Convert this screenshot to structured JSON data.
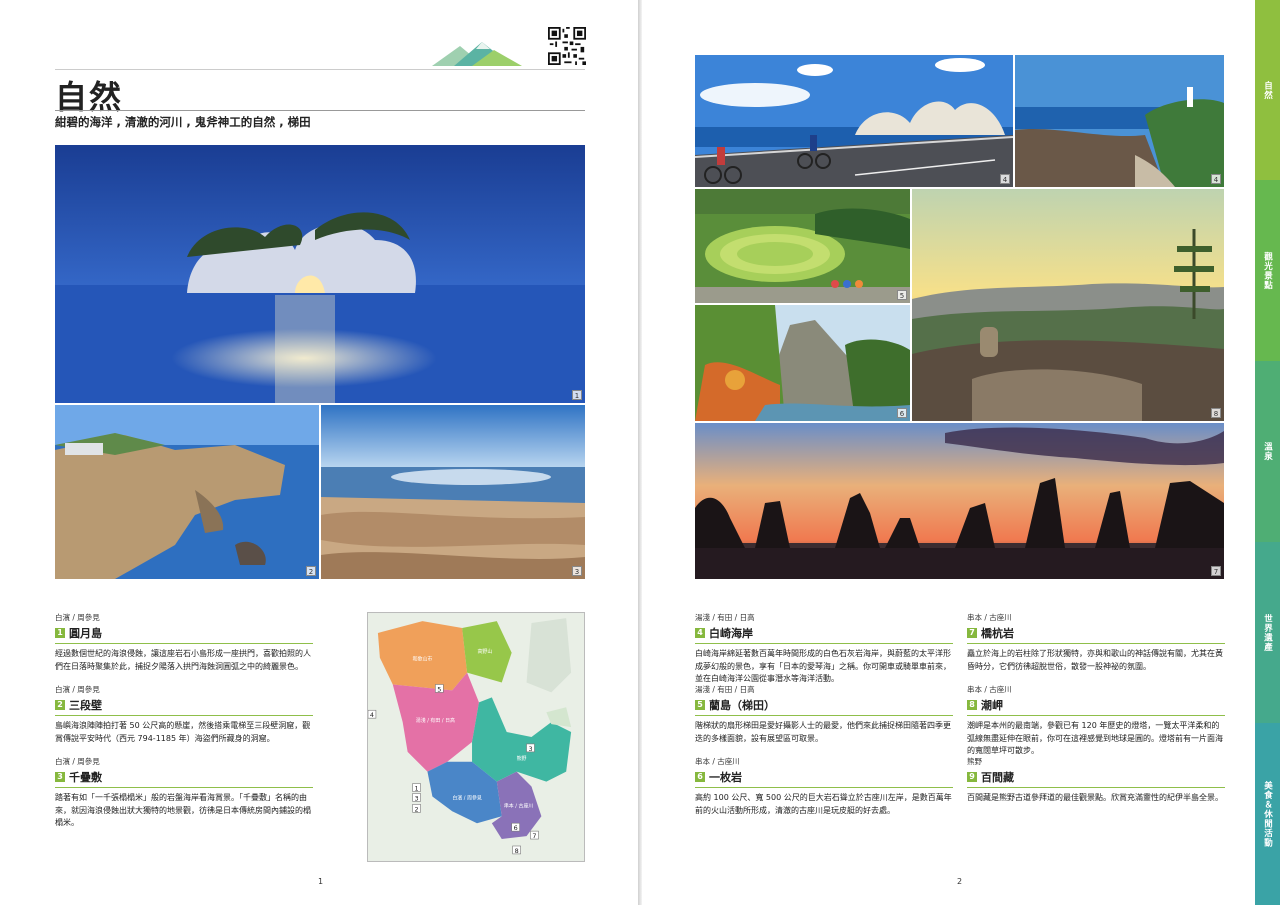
{
  "header": {
    "title": "自然",
    "subtitle": "紺碧的海洋 , 清澈的河川 , 鬼斧神工的自然 , 梯田"
  },
  "left_photos": [
    {
      "num": "1",
      "subject": "engetsu-island-moon"
    },
    {
      "num": "2",
      "subject": "sandanheki-cliffs"
    },
    {
      "num": "3",
      "subject": "senjojiki-rock-shelf"
    }
  ],
  "right_photos": [
    {
      "num": "4",
      "subject": "shirasaki-coast-cycling"
    },
    {
      "num": "4",
      "subject": "shirasaki-lighthouse"
    },
    {
      "num": "5",
      "subject": "aragijima-rice-terraces"
    },
    {
      "num": "6",
      "subject": "ichimaiiwa-autumn-gorge"
    },
    {
      "num": "8",
      "subject": "shionomisaki-sunset"
    },
    {
      "num": "7",
      "subject": "hashikuiiwa-silhouette"
    }
  ],
  "entries": [
    {
      "loc": "白濱 / 周參見",
      "num": "1",
      "name": "圓月島",
      "desc": "經過數個世紀的海浪侵蝕，讓這座岩石小島形成一座拱門，喜歡拍照的人們在日落時聚集於此，捕捉夕陽落入拱門海蝕洞圓弧之中的綺麗景色。"
    },
    {
      "loc": "白濱 / 周參見",
      "num": "2",
      "name": "三段壁",
      "desc": "島嶼海浪陣陣拍打著 50 公尺高的懸崖，然後搭乘電梯至三段壁洞窟，觀賞傳說平安時代（西元 794-1185 年）海盜們所藏身的洞窟。"
    },
    {
      "loc": "白濱 / 周參見",
      "num": "3",
      "name": "千疊敷",
      "desc": "踏著有如「一千張榻榻米」般的岩盤海岸看海賞景。「千疊敷」名稱的由來，就因海浪侵蝕出狀大獨特的地景觀，彷彿是日本傳統房間內鋪設的榻榻米。"
    },
    {
      "loc": "湯淺 / 有田 / 日高",
      "num": "4",
      "name": "白崎海岸",
      "desc": "白崎海岸綿延著數百萬年時間形成的白色石灰岩海岸，與蔚藍的太平洋形成夢幻般的景色，享有「日本的愛琴海」之稱。你可開車或騎單車前來，並在白崎海洋公園從事潛水等海洋活動。"
    },
    {
      "loc": "湯淺 / 有田 / 日高",
      "num": "5",
      "name": "藺島（梯田）",
      "desc": "階梯狀的扇形梯田是愛好攝影人士的最愛，他們來此捕捉梯田隨著四季更迭的多樣面貌，設有展望區可取景。"
    },
    {
      "loc": "串本 / 古座川",
      "num": "6",
      "name": "一枚岩",
      "desc": "高約 100 公尺、寬 500 公尺的巨大岩石聳立於古座川左岸，是數百萬年前的火山活動所形成，清澈的古座川是玩皮艇的好去處。"
    },
    {
      "loc": "串本 / 古座川",
      "num": "7",
      "name": "橋杭岩",
      "desc": "矗立於海上的岩柱除了形狀獨特，亦與和歌山的神話傳說有關，尤其在黃昏時分，它們彷彿超脫世俗，散發一股神祕的氛圍。"
    },
    {
      "loc": "串本 / 古座川",
      "num": "8",
      "name": "潮岬",
      "desc": "潮岬是本州的最南端，參觀已有 120 年歷史的燈塔，一覽太平洋柔和的弧線無盡延伸在眼前，你可在這裡感覺到地球是圓的。燈塔前有一片面海的寬闊草坪可散步。"
    },
    {
      "loc": "熊野",
      "num": "9",
      "name": "百間藏",
      "desc": "百間藏是熊野古道參拜道的最佳觀景點。欣賞充滿靈性的紀伊半島全景。"
    }
  ],
  "map": {
    "regions": [
      "和歌山市",
      "高野山",
      "湯淺 / 有田 / 日高",
      "熊野",
      "白濱 / 周參見",
      "串本 / 古座川"
    ],
    "labels": [
      "4",
      "5",
      "3",
      "1",
      "3",
      "2",
      "6",
      "7",
      "8"
    ]
  },
  "folio": {
    "left": "1",
    "right": "2"
  },
  "tabs": [
    {
      "label": "自然",
      "color": "#8fbf3f"
    },
    {
      "label": "觀光景點",
      "color": "#66b84f"
    },
    {
      "label": "溫泉",
      "color": "#4fae74"
    },
    {
      "label": "世界遺產",
      "color": "#45a98c"
    },
    {
      "label": "美食＆休閒活動",
      "color": "#3aa3a6"
    }
  ]
}
